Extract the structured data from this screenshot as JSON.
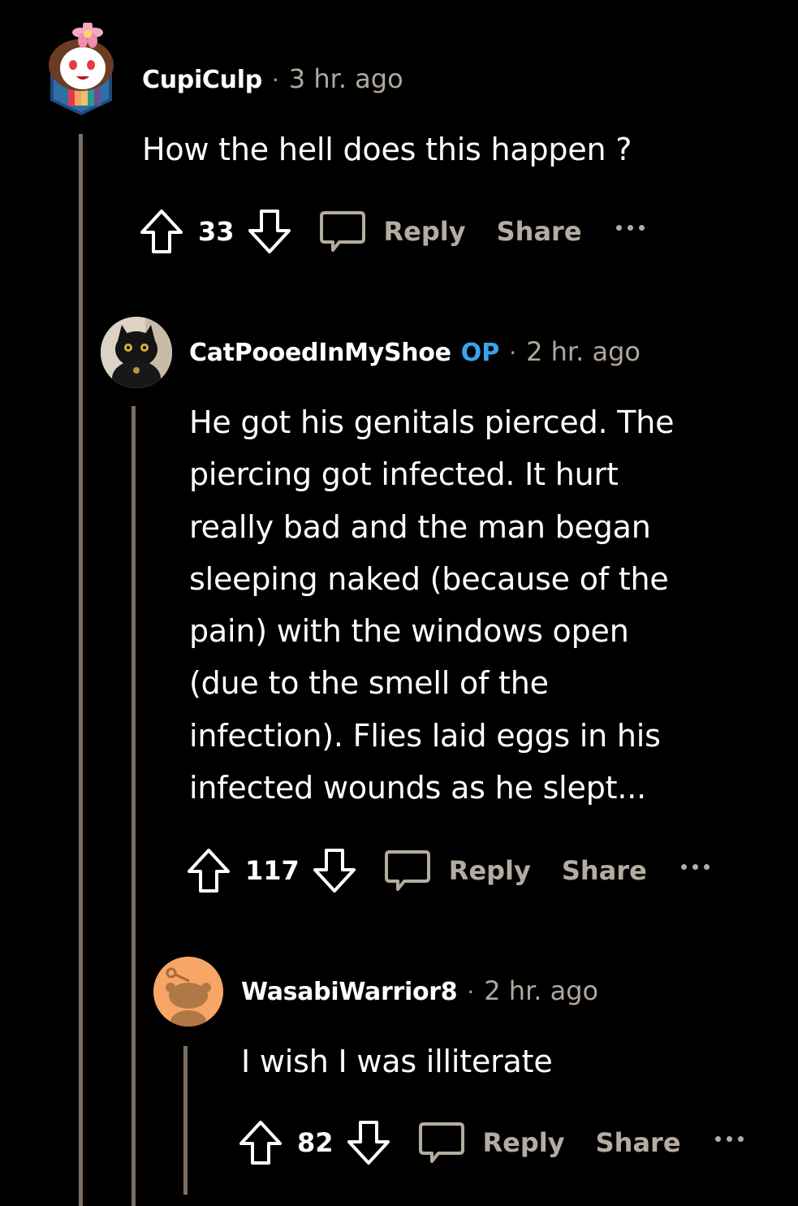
{
  "colors": {
    "background": "#000000",
    "thread_line": "#7c6f62",
    "op_badge": "#3aa2ef",
    "muted_text": "#b1a79c"
  },
  "comments": [
    {
      "username": "CupiCulp",
      "separator": "·",
      "timestamp": "3 hr. ago",
      "body": "How the hell does this happen ?",
      "score": "33",
      "reply_label": "Reply",
      "share_label": "Share",
      "avatar_icon": "pink-flower-character-avatar"
    },
    {
      "username": "CatPooedInMyShoe",
      "badge": "OP",
      "separator": "·",
      "timestamp": "2 hr. ago",
      "body_lines": [
        "He got his genitals pierced. The",
        "piercing got infected. It hurt",
        "really bad and the man began",
        "sleeping naked (because of the",
        "pain) with the windows open",
        "(due to the smell of the",
        "infection). Flies laid eggs in his",
        "infected wounds as he slept..."
      ],
      "score": "117",
      "reply_label": "Reply",
      "share_label": "Share",
      "avatar_icon": "black-cat-photo-avatar"
    },
    {
      "username": "WasabiWarrior8",
      "separator": "·",
      "timestamp": "2 hr. ago",
      "body": "I wish I was illiterate",
      "score": "82",
      "reply_label": "Reply",
      "share_label": "Share",
      "avatar_icon": "default-snoo-avatar"
    }
  ]
}
